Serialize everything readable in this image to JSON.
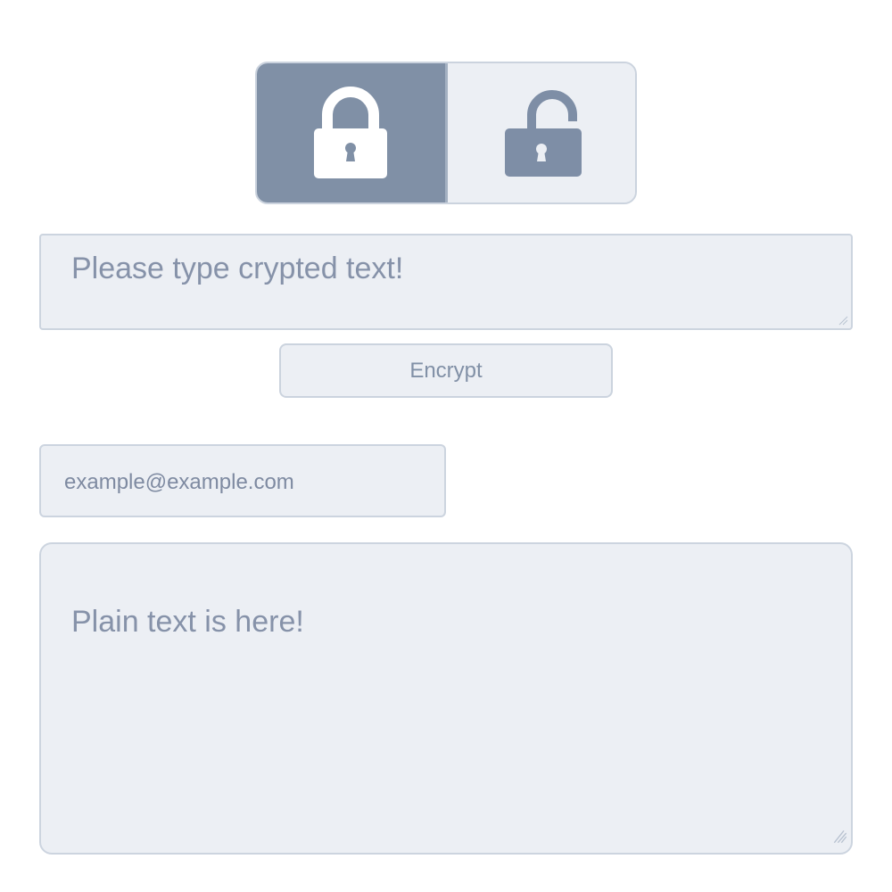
{
  "mode_toggle": {
    "active_mode": "encrypt",
    "modes": [
      {
        "id": "encrypt",
        "icon": "lock-closed-icon",
        "active": true
      },
      {
        "id": "decrypt",
        "icon": "lock-open-icon",
        "active": false
      }
    ]
  },
  "crypted_input": {
    "placeholder": "Please type crypted text!"
  },
  "encrypt_button": {
    "label": "Encrypt"
  },
  "email_input": {
    "placeholder": "example@example.com"
  },
  "plain_output": {
    "placeholder": "Plain text is here!"
  },
  "colors": {
    "active_mode_bg": "#8090a6",
    "field_bg": "#eceff4",
    "border": "#ccd4df",
    "text_muted": "#8692a9"
  }
}
